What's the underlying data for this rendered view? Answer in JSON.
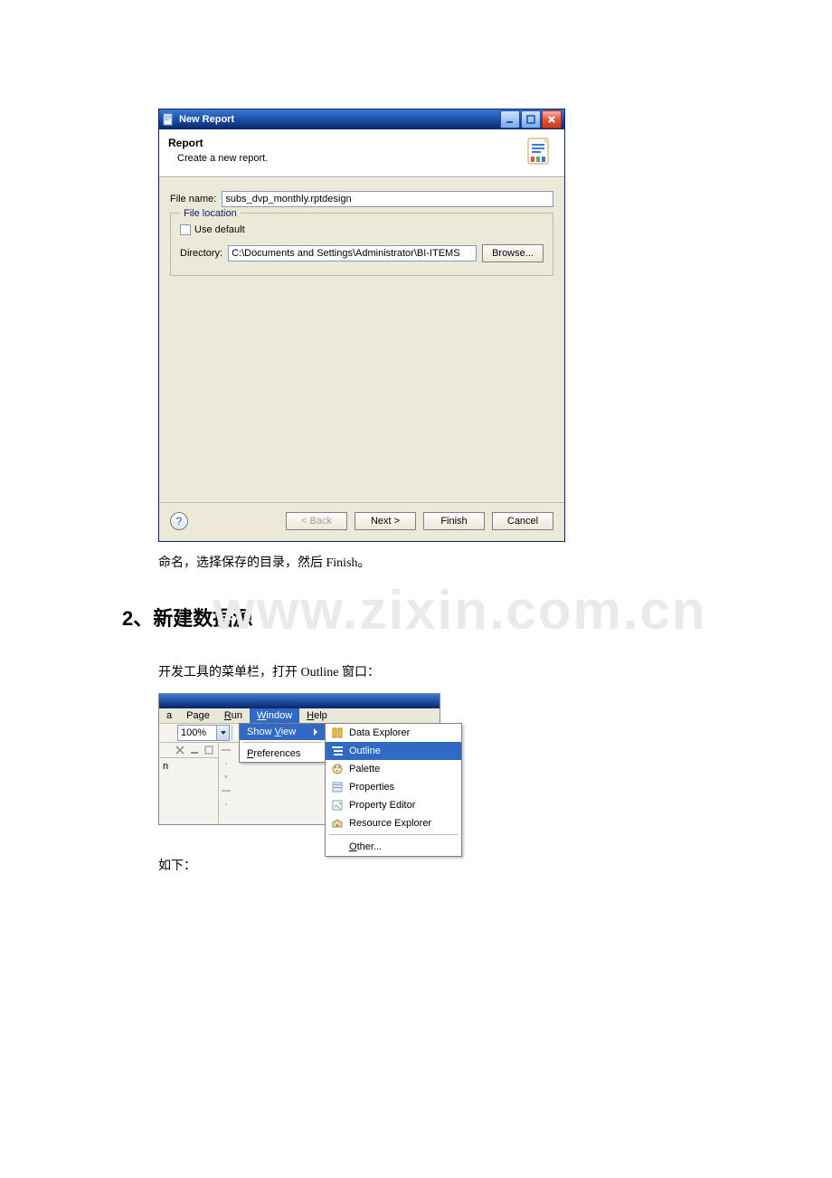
{
  "dialog": {
    "title": "New Report",
    "header": "Report",
    "subheader": "Create a new report.",
    "file_name_label": "File name:",
    "file_name_value": "subs_dvp_monthly.rptdesign",
    "fieldset_legend": "File location",
    "use_default_label": "Use default",
    "directory_label": "Directory:",
    "directory_value": "C:\\Documents and Settings\\Administrator\\BI-ITEMS",
    "browse_label": "Browse...",
    "back_label": "< Back",
    "next_label": "Next >",
    "finish_label": "Finish",
    "cancel_label": "Cancel",
    "help_glyph": "?"
  },
  "caption_after_dialog": "命名，选择保存的目录，然后 Finish。",
  "section_title": "2、新建数据源",
  "paragraph_open_outline": "开发工具的菜单栏，打开 Outline 窗口：",
  "ide": {
    "menubar": {
      "a": "a",
      "page": "Page",
      "run": "Run",
      "window": "Window",
      "help": "Help"
    },
    "zoom_value": "100%",
    "n_label": "n",
    "dropdown": {
      "show_view": "Show View",
      "preferences": "Preferences"
    },
    "fly": {
      "data_explorer": "Data Explorer",
      "outline": "Outline",
      "palette": "Palette",
      "properties": "Properties",
      "property_editor": "Property Editor",
      "resource_explorer": "Resource Explorer",
      "other": "Other..."
    }
  },
  "paragraph_as_follows": "如下："
}
